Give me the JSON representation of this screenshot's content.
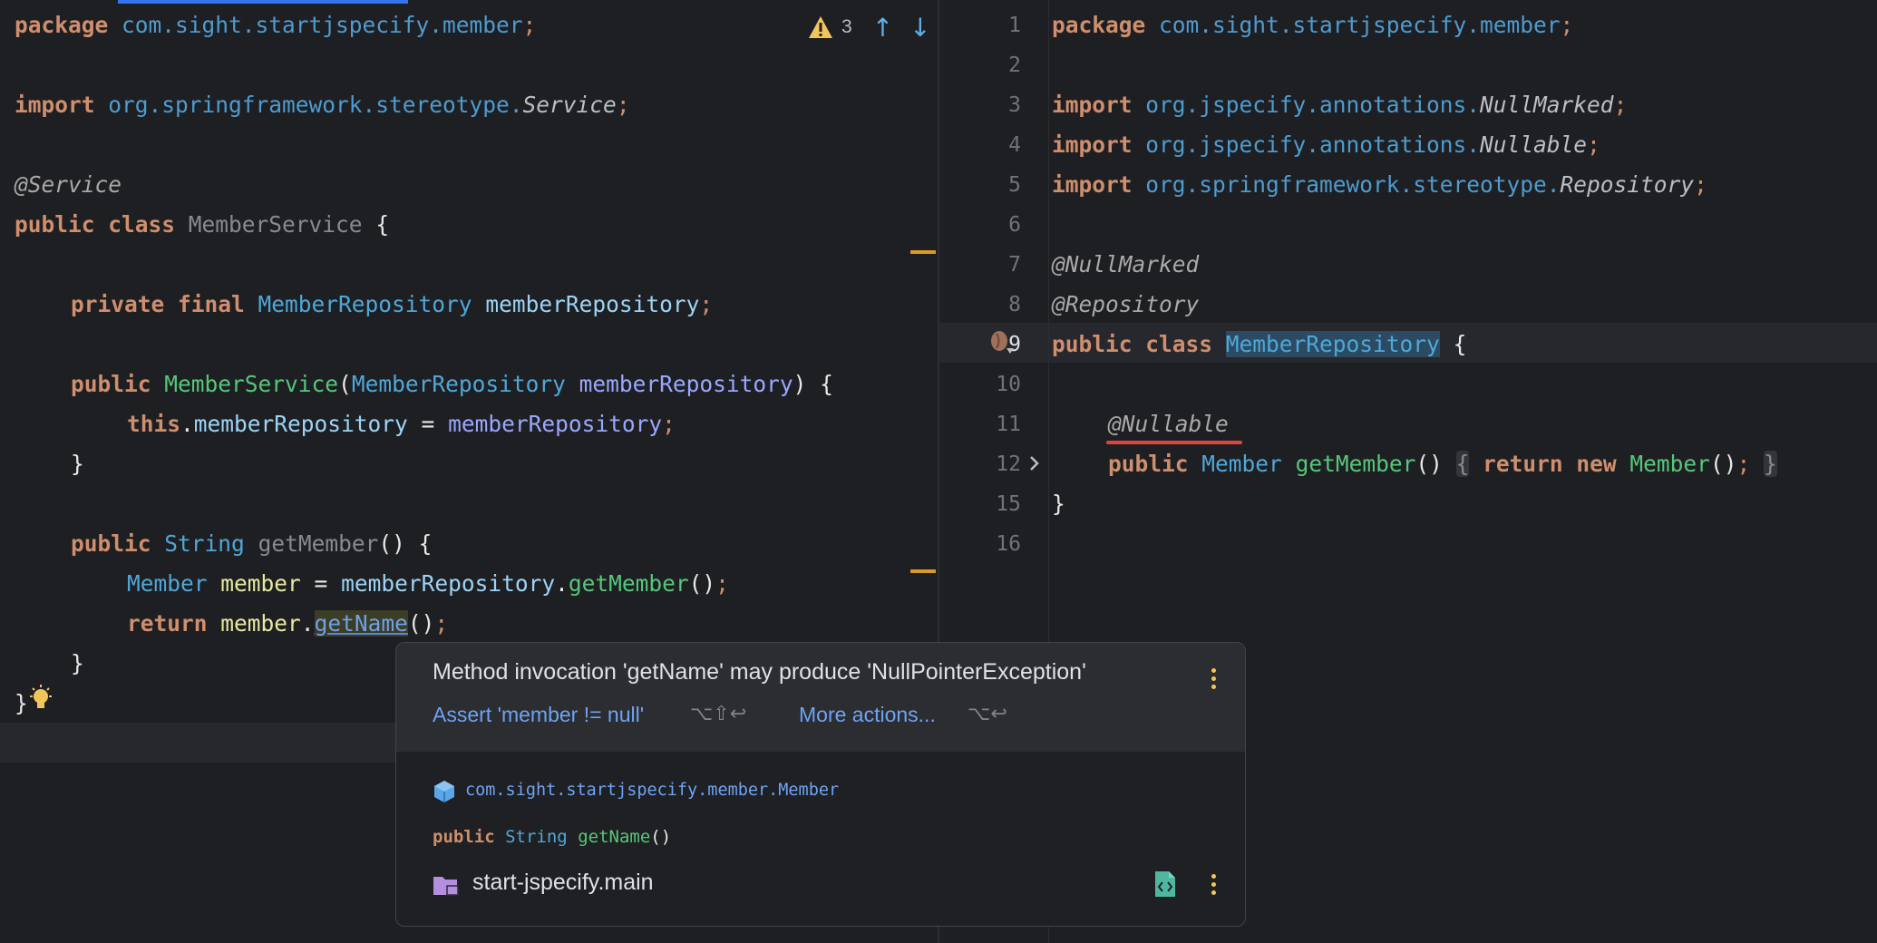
{
  "left_editor": {
    "warnings": {
      "count": "3",
      "icon": "warning-triangle-icon"
    },
    "lines": {
      "l1": {
        "kw": "package",
        "pkg": "com.sight.startjspecify.member",
        "semi": ";"
      },
      "l3": {
        "kw": "import",
        "pkg": "org.springframework.stereotype.",
        "cls": "Service",
        "semi": ";"
      },
      "l5": {
        "ann": "@Service"
      },
      "l6": {
        "kw": "public class",
        "name": "MemberService",
        "brace": "{"
      },
      "l8": {
        "kw": "private final",
        "type": "MemberRepository",
        "field": "memberRepository",
        "semi": ";"
      },
      "l10": {
        "kw": "public",
        "ctor": "MemberService",
        "open": "(",
        "type": "MemberRepository",
        "param": "memberRepository",
        "close": ") {"
      },
      "l11": {
        "kw": "this",
        "dot": ".",
        "field": "memberRepository",
        "eq": " = ",
        "param": "memberRepository",
        "semi": ";"
      },
      "l12": {
        "brace": "}"
      },
      "l14": {
        "kw": "public",
        "type": "String",
        "name": "getMember",
        "rest": "() {"
      },
      "l15": {
        "type": "Member",
        "var": "member",
        "eq": " = ",
        "field": "memberRepository",
        "dot": ".",
        "method": "getMember",
        "paren": "()",
        "semi": ";"
      },
      "l16": {
        "kw": "return",
        "var": "member",
        "dot": ".",
        "method": "getName",
        "paren": "()",
        "semi": ";"
      },
      "l17": {
        "brace": "}"
      },
      "l18": {
        "brace": "}"
      }
    }
  },
  "right_editor": {
    "line_numbers": [
      "1",
      "2",
      "3",
      "4",
      "5",
      "6",
      "7",
      "8",
      "9",
      "10",
      "11",
      "12",
      "15",
      "16"
    ],
    "lines": {
      "r1": {
        "kw": "package",
        "pkg": "com.sight.startjspecify.member",
        "semi": ";"
      },
      "r3": {
        "kw": "import",
        "pkg": "org.jspecify.annotations.",
        "cls": "NullMarked",
        "semi": ";"
      },
      "r4": {
        "kw": "import",
        "pkg": "org.jspecify.annotations.",
        "cls": "Nullable",
        "semi": ";"
      },
      "r5": {
        "kw": "import",
        "pkg": "org.springframework.stereotype.",
        "cls": "Repository",
        "semi": ";"
      },
      "r7": {
        "ann": "@NullMarked"
      },
      "r8": {
        "ann": "@Repository"
      },
      "r9": {
        "kw": "public class",
        "name": "MemberRepository",
        "brace": "{"
      },
      "r11": {
        "ann": "@Nullable"
      },
      "r12": {
        "kw": "public",
        "type": "Member",
        "method": "getMember",
        "paren": "()",
        "fold_open": "{",
        "kw2": "return new",
        "ctor": "Member",
        "paren2": "()",
        "semi": ";",
        "fold_close": "}"
      },
      "r15": {
        "brace": "}"
      }
    }
  },
  "popup": {
    "message": "Method invocation 'getName' may produce 'NullPointerException'",
    "action1": {
      "label": "Assert 'member != null'",
      "shortcut": "⌥⇧↩"
    },
    "action2": {
      "label": "More actions...",
      "shortcut": "⌥↩"
    },
    "doc_fqn": "com.sight.startjspecify.member.Member",
    "doc_sig": {
      "kw": "public",
      "type": "String",
      "method": "getName",
      "paren": "()"
    },
    "module": "start-jspecify.main"
  }
}
